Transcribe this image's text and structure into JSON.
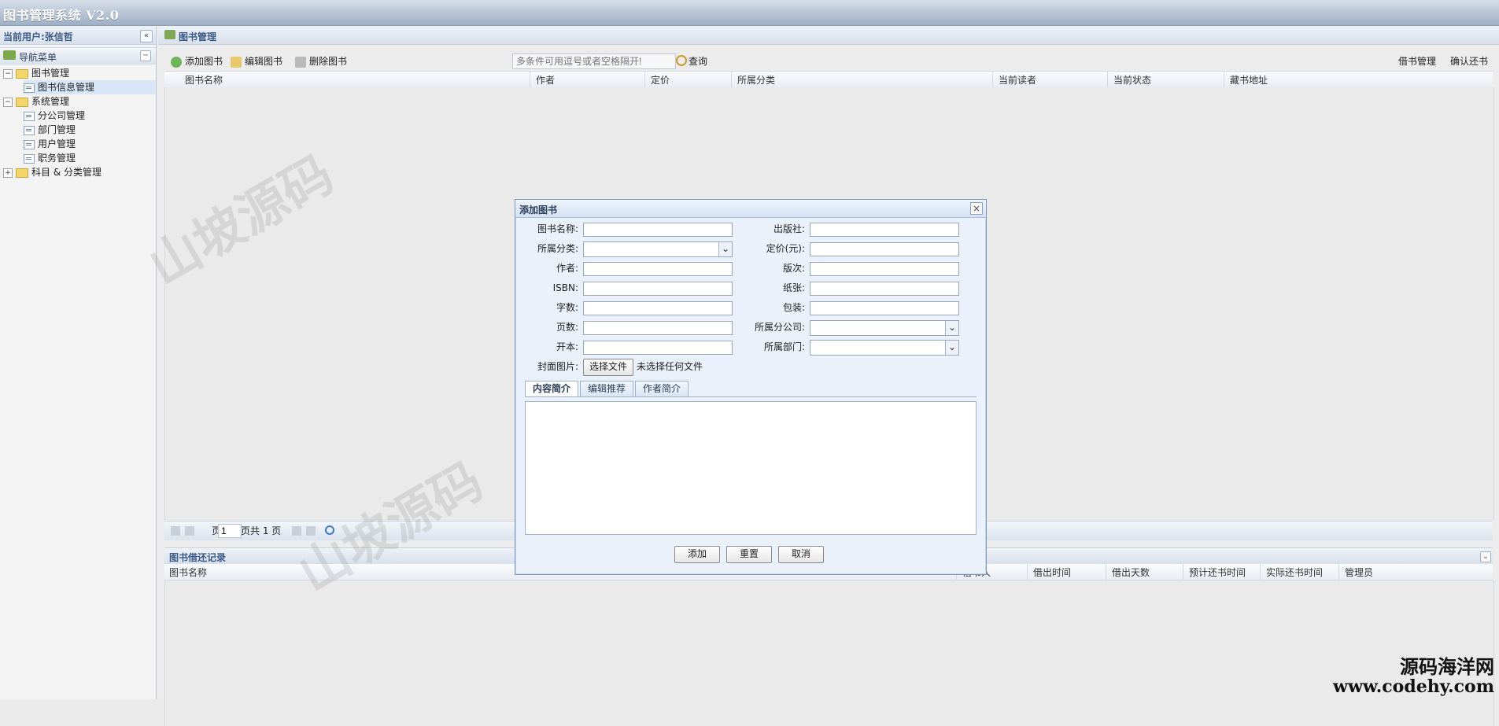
{
  "app": {
    "title": "图书管理系统 V2.0"
  },
  "left": {
    "current_user": "当前用户:张信哲",
    "collapse_label": "«",
    "nav_title": "导航菜单",
    "nav_minus": "−",
    "tree": [
      {
        "type": "folder",
        "label": "图书管理",
        "toggle": "−"
      },
      {
        "type": "file",
        "label": "图书信息管理"
      },
      {
        "type": "folder",
        "label": "系统管理",
        "toggle": "−"
      },
      {
        "type": "file",
        "label": "分公司管理"
      },
      {
        "type": "file",
        "label": "部门管理"
      },
      {
        "type": "file",
        "label": "用户管理"
      },
      {
        "type": "file",
        "label": "职务管理"
      },
      {
        "type": "folder",
        "label": "科目 & 分类管理",
        "toggle": "+"
      }
    ]
  },
  "main": {
    "title": "图书管理",
    "toolbar": {
      "add": "添加图书",
      "edit": "编辑图书",
      "delete": "删除图书",
      "search_placeholder": "多条件可用逗号或者空格隔开!",
      "search_label": "查询",
      "borrow": "借书管理",
      "return": "确认还书"
    },
    "columns": [
      "图书名称",
      "作者",
      "定价",
      "所属分类",
      "当前读者",
      "当前状态",
      "藏书地址"
    ],
    "pager": {
      "page_label": "页",
      "page_value": "1",
      "total": "页共 1 页"
    }
  },
  "history": {
    "title": "图书借还记录",
    "collapse": "⌄",
    "columns": [
      "图书名称",
      "借书人",
      "借出时间",
      "借出天数",
      "预计还书时间",
      "实际还书时间",
      "管理员"
    ]
  },
  "modal": {
    "title": "添加图书",
    "close": "×",
    "labels": {
      "book_name": "图书名称:",
      "publisher": "出版社:",
      "category": "所属分类:",
      "price": "定价(元):",
      "author": "作者:",
      "edition": "版次:",
      "isbn": "ISBN:",
      "paper": "纸张:",
      "word_count": "字数:",
      "binding": "包装:",
      "page_count": "页数:",
      "branch": "所属分公司:",
      "format": "开本:",
      "department": "所属部门:",
      "cover": "封面图片:"
    },
    "file_button": "选择文件",
    "file_status": "未选择任何文件",
    "tabs": [
      "内容简介",
      "编辑推荐",
      "作者简介"
    ],
    "buttons": {
      "add": "添加",
      "reset": "重置",
      "cancel": "取消"
    }
  },
  "watermarks": [
    "山坡源码",
    "山坡源码"
  ],
  "brand": {
    "cn": "源码海洋网",
    "en": "www.codehy.com"
  },
  "colors": {
    "accent": "#3c5a86",
    "header_gradient_top": "#d6dde8",
    "header_gradient_bottom": "#9fb0c6"
  }
}
